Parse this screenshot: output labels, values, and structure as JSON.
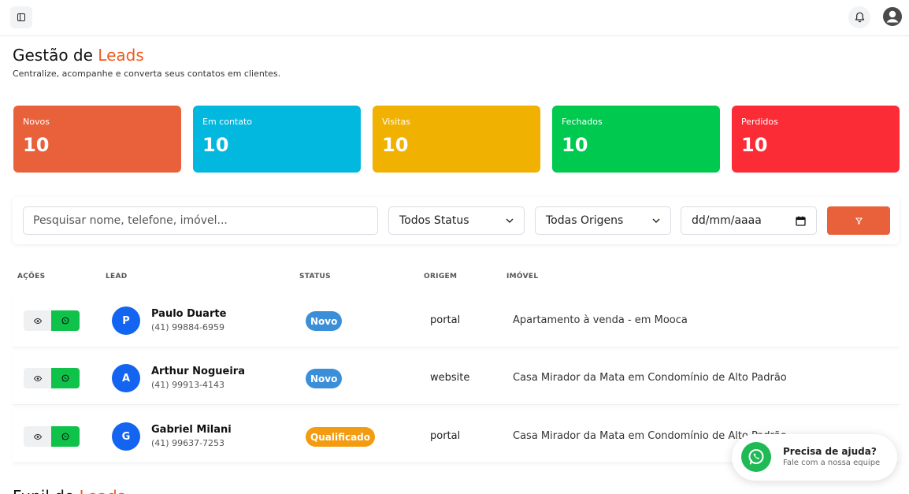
{
  "header": {
    "title_main": "Gestão de ",
    "title_accent": "Leads",
    "subtitle": "Centralize, acompanhe e converta seus contatos em clientes."
  },
  "stats": [
    {
      "label": "Novos",
      "value": "10",
      "color": "#e8613a"
    },
    {
      "label": "Em contato",
      "value": "10",
      "color": "#03b8de"
    },
    {
      "label": "Visitas",
      "value": "10",
      "color": "#f0b100"
    },
    {
      "label": "Fechados",
      "value": "10",
      "color": "#00c950"
    },
    {
      "label": "Perdidos",
      "value": "10",
      "color": "#fb2c36"
    }
  ],
  "filters": {
    "search_placeholder": "Pesquisar nome, telefone, imóvel...",
    "status_selected": "Todos Status",
    "origin_selected": "Todas Origens",
    "date_placeholder": "dd/mm/aaaa"
  },
  "table": {
    "headers": [
      "AÇÕES",
      "LEAD",
      "STATUS",
      "ORIGEM",
      "IMÓVEL"
    ],
    "rows": [
      {
        "initial": "P",
        "name": "Paulo Duarte",
        "phone": "(41) 99884-6959",
        "status": "Novo",
        "status_color": "#3b8fd9",
        "origin": "portal",
        "property": "Apartamento à venda - em Mooca"
      },
      {
        "initial": "A",
        "name": "Arthur Nogueira",
        "phone": "(41) 99913-4143",
        "status": "Novo",
        "status_color": "#3b8fd9",
        "origin": "website",
        "property": "Casa Mirador da Mata em Condomínio de Alto Padrão"
      },
      {
        "initial": "G",
        "name": "Gabriel Milani",
        "phone": "(41) 99637-7253",
        "status": "Qualificado",
        "status_color": "#f39c12",
        "origin": "portal",
        "property": "Casa Mirador da Mata em Condomínio de Alto Padrão"
      }
    ]
  },
  "help": {
    "title": "Precisa de ajuda?",
    "subtitle": "Fale com a nossa equipe"
  },
  "next_section": {
    "title_main": "Funil de ",
    "title_accent": "Leads"
  },
  "icons": {
    "sidebar_toggle": "sidebar-icon",
    "notification": "bell-icon",
    "profile": "user-circle-icon",
    "filter": "funnel-icon",
    "view": "eye-icon",
    "whatsapp": "whatsapp-icon",
    "calendar": "calendar-icon"
  }
}
